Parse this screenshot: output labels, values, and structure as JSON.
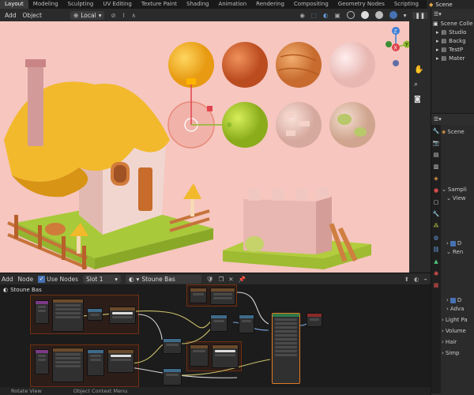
{
  "workspace_tabs": [
    "Layout",
    "Modeling",
    "Sculpting",
    "UV Editing",
    "Texture Paint",
    "Shading",
    "Animation",
    "Rendering",
    "Compositing",
    "Geometry Nodes",
    "Scripting"
  ],
  "scene_selector": "Scene",
  "viewport_header": {
    "add": "Add",
    "object": "Object",
    "transform_orientation": "Local"
  },
  "outliner": {
    "items": [
      "Scene Colle",
      "Studio",
      "Backg",
      "TestP",
      "Mater"
    ]
  },
  "properties": {
    "scene_label": "Scene",
    "rows": [
      "Sampli",
      "View",
      "D",
      "Ren",
      "D",
      "Adva",
      "Light Pa",
      "Volume",
      "Hair",
      "Simp"
    ]
  },
  "node_header": {
    "add": "Add",
    "node": "Node",
    "use_nodes": "Use Nodes",
    "slot": "Slot 1",
    "material": "Stoune Bas"
  },
  "node_editor": {
    "breadcrumb": "Stoune Bas"
  },
  "status_bar": {
    "left": "Rotate View",
    "middle": "Object Context Menu"
  },
  "colors": {
    "accent": "#4772b3",
    "viewport_bg": "#f6c6bf",
    "roof_yellow": "#f2b92c",
    "grass": "#a9c83a",
    "gizmo_x": "#e0444c",
    "gizmo_y": "#8ab92a",
    "gizmo_z": "#3f7fd6"
  },
  "icons": [
    "editor-type-icon",
    "mode-icon",
    "overlay-icon",
    "shading-solid-icon",
    "hand-icon",
    "zoom-icon",
    "camera-icon",
    "grid-icon",
    "pin-icon",
    "filter-icon",
    "render-icon",
    "output-icon",
    "scene-icon",
    "world-icon",
    "object-icon",
    "modifier-icon",
    "particles-icon",
    "physics-icon",
    "constraints-icon",
    "data-icon",
    "material-icon",
    "texture-icon"
  ]
}
